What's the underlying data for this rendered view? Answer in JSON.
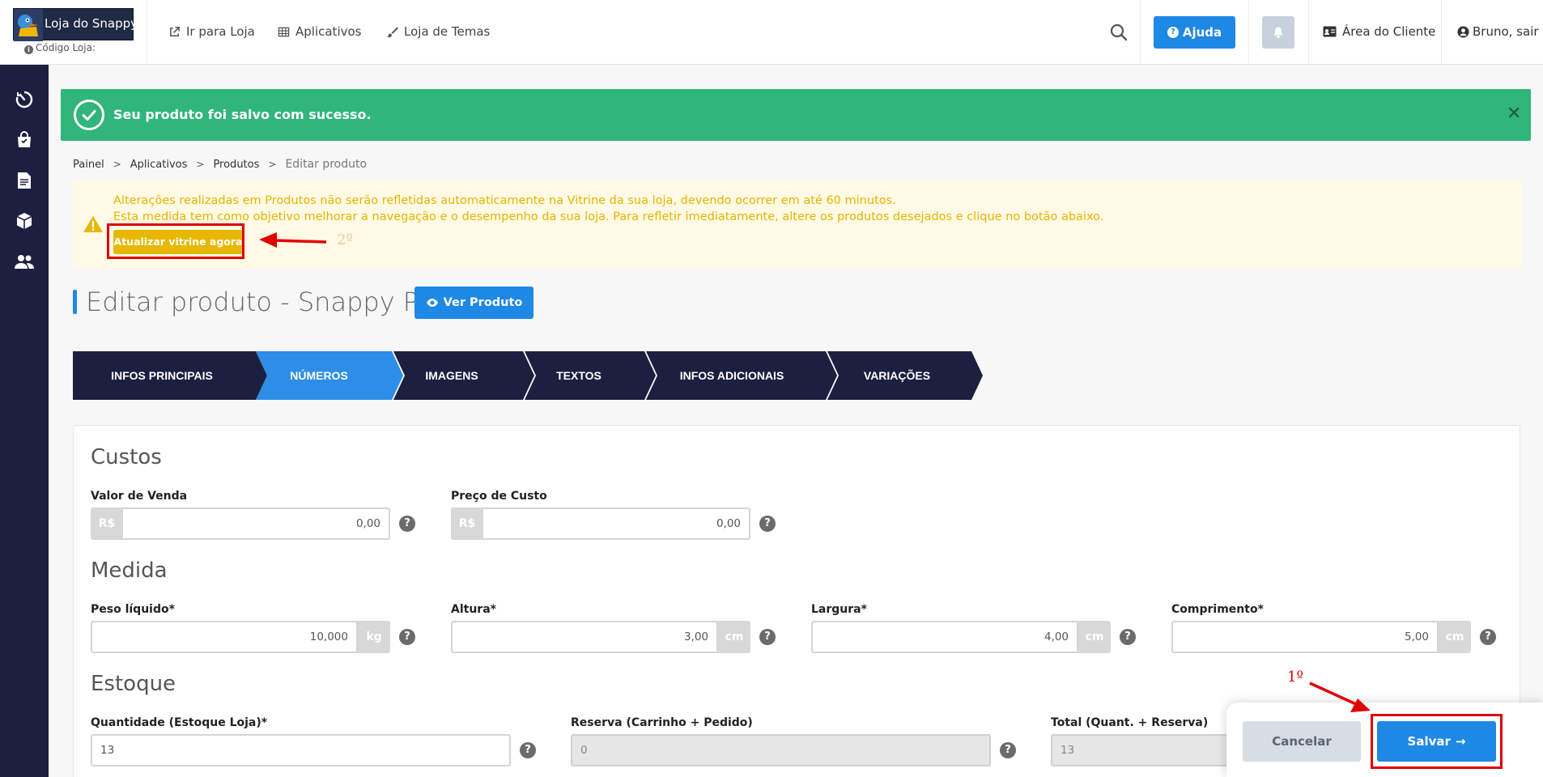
{
  "header": {
    "logo_text": "Loja do Snappy",
    "store_code_label": "Código Loja:",
    "nav": [
      {
        "label": "Ir para Loja",
        "icon": "external-link-icon"
      },
      {
        "label": "Aplicativos",
        "icon": "grid-icon"
      },
      {
        "label": "Loja de Temas",
        "icon": "brush-icon"
      }
    ],
    "help_label": "Ajuda",
    "client_area_label": "Área do Cliente",
    "user_label": "Bruno, sair"
  },
  "sidebar": {
    "items": [
      {
        "icon": "speed-icon"
      },
      {
        "icon": "shopping-bag-icon"
      },
      {
        "icon": "document-icon"
      },
      {
        "icon": "box-icon"
      },
      {
        "icon": "users-icon"
      }
    ]
  },
  "alert": {
    "message": "Seu produto foi salvo com sucesso.",
    "close": "✕"
  },
  "breadcrumb": {
    "items": [
      "Painel",
      "Aplicativos",
      "Produtos"
    ],
    "current": "Editar produto"
  },
  "warning": {
    "line1": "Alterações realizadas em Produtos não serão refletidas automaticamente na Vitrine da sua loja, devendo ocorrer em até 60 minutos.",
    "line2": "Esta medida tem como objetivo melhorar a navegação e o desempenho da sua loja. Para refletir imediatamente, altere os produtos desejados e clique no botão abaixo.",
    "button": "Atualizar vitrine agora"
  },
  "annotations": {
    "label_first": "1º",
    "label_second": "2º"
  },
  "page": {
    "title": "Editar produto - Snappy P",
    "view_button": "Ver Produto"
  },
  "tabs": [
    {
      "label": "INFOS PRINCIPAIS",
      "active": false
    },
    {
      "label": "NÚMEROS",
      "active": true
    },
    {
      "label": "IMAGENS",
      "active": false
    },
    {
      "label": "TEXTOS",
      "active": false
    },
    {
      "label": "INFOS ADICIONAIS",
      "active": false
    },
    {
      "label": "VARIAÇÕES",
      "active": false
    }
  ],
  "form": {
    "costs": {
      "title": "Custos",
      "sale_value": {
        "label": "Valor de Venda",
        "prefix": "R$",
        "value": "0,00"
      },
      "cost_price": {
        "label": "Preço de Custo",
        "prefix": "R$",
        "value": "0,00"
      }
    },
    "measure": {
      "title": "Medida",
      "weight": {
        "label": "Peso líquido*",
        "value": "10,000",
        "suffix": "kg"
      },
      "height": {
        "label": "Altura*",
        "value": "3,00",
        "suffix": "cm"
      },
      "width": {
        "label": "Largura*",
        "value": "4,00",
        "suffix": "cm"
      },
      "length": {
        "label": "Comprimento*",
        "value": "5,00",
        "suffix": "cm"
      }
    },
    "stock": {
      "title": "Estoque",
      "quantity": {
        "label": "Quantidade (Estoque Loja)*",
        "value": "13"
      },
      "reserve": {
        "label": "Reserva (Carrinho + Pedido)",
        "value": "0"
      },
      "total": {
        "label": "Total (Quant. + Reserva)",
        "value": "13"
      }
    },
    "help_glyph": "?"
  },
  "actions": {
    "cancel": "Cancelar",
    "save": "Salvar",
    "save_arrow": "→"
  },
  "colors": {
    "sidebar": "#1d1f41",
    "primary": "#1e88e5",
    "success": "#30b57a",
    "warning_text": "#e8b300",
    "tab_dark": "#1d1f41",
    "annotation": "#e00000"
  }
}
